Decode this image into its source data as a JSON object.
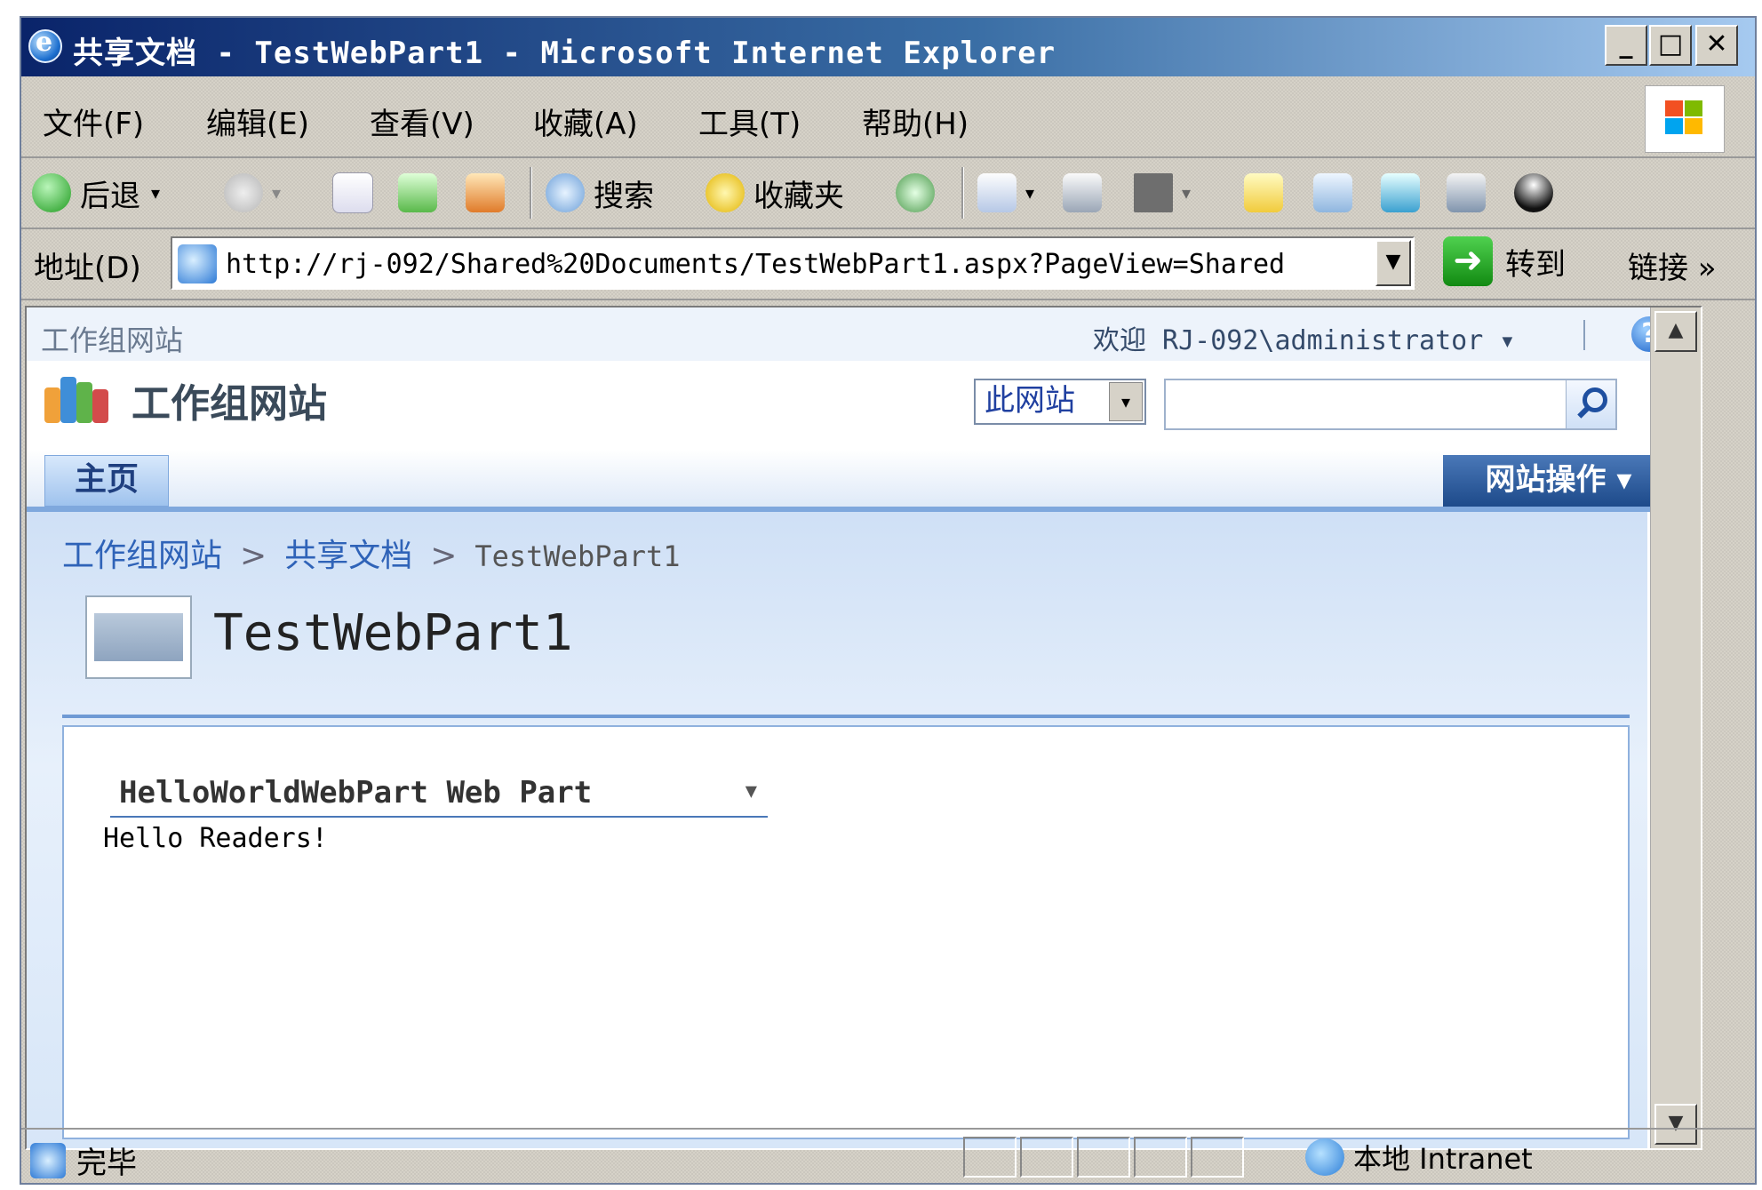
{
  "window": {
    "title": "共享文档 - TestWebPart1 - Microsoft Internet Explorer",
    "minimize": "_",
    "maximize": "□",
    "close": "✕"
  },
  "menu": [
    "文件(F)",
    "编辑(E)",
    "查看(V)",
    "收藏(A)",
    "工具(T)",
    "帮助(H)"
  ],
  "toolbar": {
    "back": "后退",
    "search": "搜索",
    "favorites": "收藏夹"
  },
  "address": {
    "label": "地址(D)",
    "url": "http://rj-092/Shared%20Documents/TestWebPart1.aspx?PageView=Shared",
    "go": "转到",
    "links": "链接 »"
  },
  "sharepoint": {
    "top_site": "工作组网站",
    "welcome": "欢迎 RJ-092\\administrator ▾",
    "site_title": "工作组网站",
    "scope": "此网站",
    "search_placeholder": "",
    "tab_home": "主页",
    "site_actions": "网站操作 ▾"
  },
  "breadcrumb": [
    "工作组网站",
    "共享文档",
    "TestWebPart1"
  ],
  "page_title": "TestWebPart1",
  "webpart": {
    "title": "HelloWorldWebPart Web Part",
    "content": "Hello Readers!"
  },
  "status": {
    "text": "完毕",
    "zone": "本地 Intranet"
  },
  "colors": {
    "titlebar_start": "#0a246a",
    "link": "#2f63b8",
    "site_actions": "#1d4a8a"
  }
}
